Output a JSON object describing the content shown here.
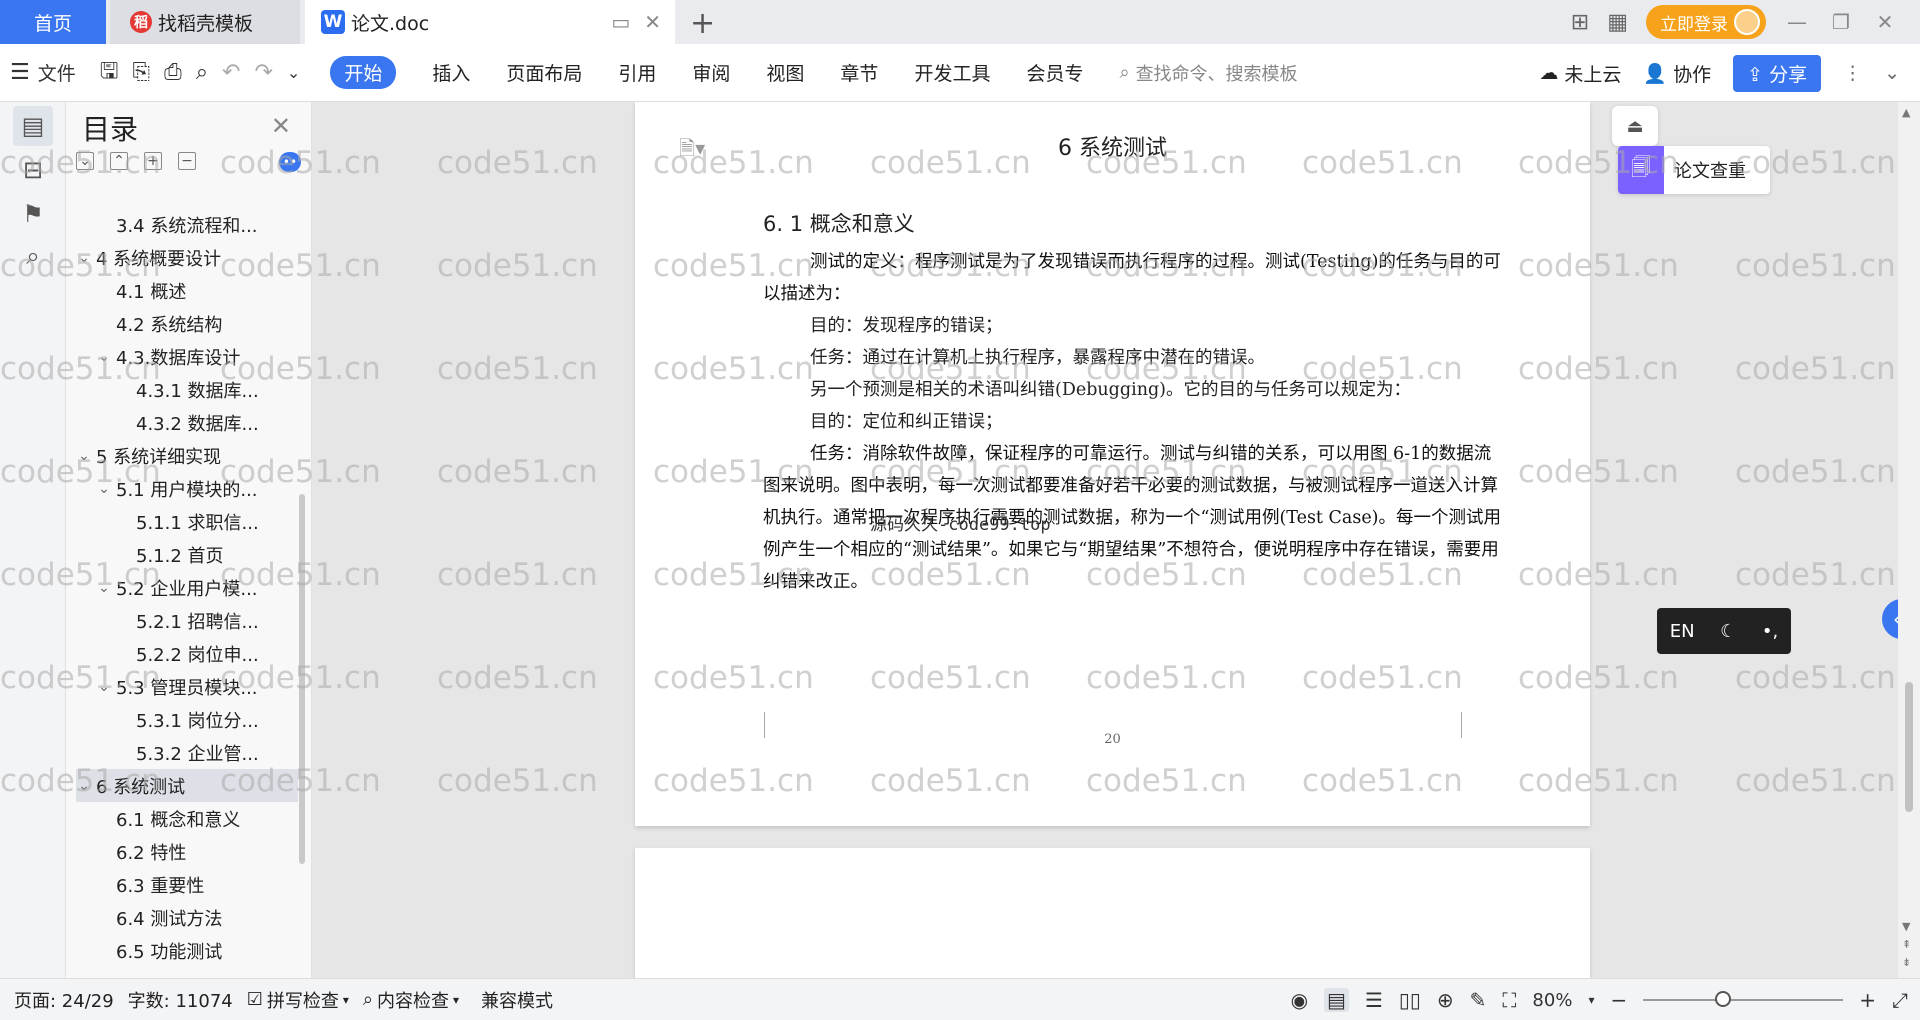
{
  "tabs": {
    "home": "首页",
    "template": "找稻壳模板",
    "doc": "论文.doc"
  },
  "header": {
    "login": "立即登录"
  },
  "ribbon": {
    "file": "文件",
    "menus": [
      "开始",
      "插入",
      "页面布局",
      "引用",
      "审阅",
      "视图",
      "章节",
      "开发工具",
      "会员专"
    ],
    "search_placeholder": "查找命令、搜索模板",
    "cloud": "未上云",
    "collab": "协作",
    "share": "分享"
  },
  "toc": {
    "title": "目录",
    "items": [
      {
        "label": "3.4 系统流程和...",
        "level": 2,
        "caret": ""
      },
      {
        "label": "4 系统概要设计",
        "level": 1,
        "caret": "⌄"
      },
      {
        "label": "4.1 概述",
        "level": 2,
        "caret": ""
      },
      {
        "label": "4.2 系统结构",
        "level": 2,
        "caret": ""
      },
      {
        "label": "4.3.数据库设计",
        "level": 2,
        "caret": "⌄"
      },
      {
        "label": "4.3.1 数据库...",
        "level": 3,
        "caret": ""
      },
      {
        "label": "4.3.2 数据库...",
        "level": 3,
        "caret": ""
      },
      {
        "label": "5 系统详细实现",
        "level": 1,
        "caret": "⌄"
      },
      {
        "label": "5.1 用户模块的...",
        "level": 2,
        "caret": "⌄"
      },
      {
        "label": "5.1.1 求职信...",
        "level": 3,
        "caret": ""
      },
      {
        "label": "5.1.2 首页",
        "level": 3,
        "caret": ""
      },
      {
        "label": "5.2 企业用户模...",
        "level": 2,
        "caret": "⌄"
      },
      {
        "label": "5.2.1 招聘信...",
        "level": 3,
        "caret": ""
      },
      {
        "label": "5.2.2 岗位申...",
        "level": 3,
        "caret": ""
      },
      {
        "label": "5.3 管理员模块...",
        "level": 2,
        "caret": "⌄"
      },
      {
        "label": "5.3.1 岗位分...",
        "level": 3,
        "caret": ""
      },
      {
        "label": "5.3.2 企业管...",
        "level": 3,
        "caret": ""
      },
      {
        "label": "6 系统测试",
        "level": 1,
        "caret": "⌄",
        "selected": true
      },
      {
        "label": "6.1 概念和意义",
        "level": 2,
        "caret": ""
      },
      {
        "label": "6.2 特性",
        "level": 2,
        "caret": ""
      },
      {
        "label": "6.3 重要性",
        "level": 2,
        "caret": ""
      },
      {
        "label": "6.4 测试方法",
        "level": 2,
        "caret": ""
      },
      {
        "label": "6.5 功能测试",
        "level": 2,
        "caret": ""
      }
    ]
  },
  "document": {
    "chapter_title": "6 系统测试",
    "section_title": "6. 1 概念和意义",
    "para1": "测试的定义：程序测试是为了发现错误而执行程序的过程。测试(Testing)的任务与目的可以描述为：",
    "line1": "目的：发现程序的错误；",
    "line2": "任务：通过在计算机上执行程序，暴露程序中潜在的错误。",
    "line3": "另一个预测是相关的术语叫纠错(Debugging)。它的目的与任务可以规定为：",
    "line4": "目的：定位和纠正错误；",
    "para2": "任务：消除软件故障，保证程序的可靠运行。测试与纠错的关系，可以用图 6-1的数据流图来说明。图中表明，每一次测试都要准备好若干必要的测试数据，与被测试程序一道送入计算机执行。通常把一次程序执行需要的测试数据，称为一个“测试用例(Test Case)。每一个测试用例产生一个相应的“测试结果”。如果它与“期望结果”不想符合，便说明程序中存在错误，需要用纠错来改正。",
    "overlay_text": "源码久久-code99.top",
    "page_number": "20"
  },
  "side_tools": {
    "paper_check": "论文查重",
    "ime_lang": "EN"
  },
  "watermark": "code51.cn",
  "status": {
    "page": "页面: 24/29",
    "words": "字数: 11074",
    "spell": "拼写检查",
    "content": "内容检查",
    "compat": "兼容模式",
    "zoom": "80%",
    "zoom_fraction": 0.4
  }
}
